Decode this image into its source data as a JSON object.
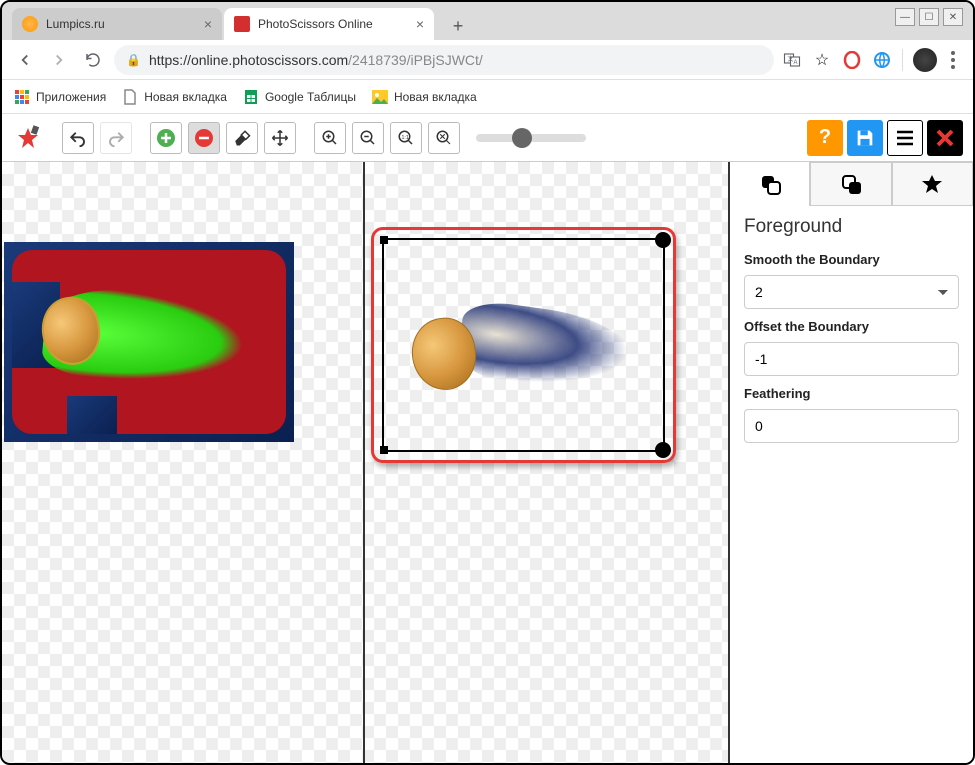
{
  "window": {
    "minimize": "—",
    "maximize": "☐",
    "close": "✕"
  },
  "tabs": [
    {
      "title": "Lumpics.ru",
      "active": false
    },
    {
      "title": "PhotoScissors Online",
      "active": true
    }
  ],
  "new_tab": "+",
  "address": {
    "scheme": "https://",
    "host": "online.photoscissors.com",
    "path": "/2418739/iPBjSJWCt/"
  },
  "bookmarks": [
    {
      "label": "Приложения",
      "icon": "grid"
    },
    {
      "label": "Новая вкладка",
      "icon": "page"
    },
    {
      "label": "Google Таблицы",
      "icon": "sheets"
    },
    {
      "label": "Новая вкладка",
      "icon": "image"
    }
  ],
  "toolbar_right": {
    "help": "?",
    "save": "💾",
    "menu": "≡",
    "close": "✖"
  },
  "panel": {
    "heading": "Foreground",
    "smooth_label": "Smooth the Boundary",
    "smooth_value": "2",
    "offset_label": "Offset the Boundary",
    "offset_value": "-1",
    "feather_label": "Feathering",
    "feather_value": "0"
  }
}
